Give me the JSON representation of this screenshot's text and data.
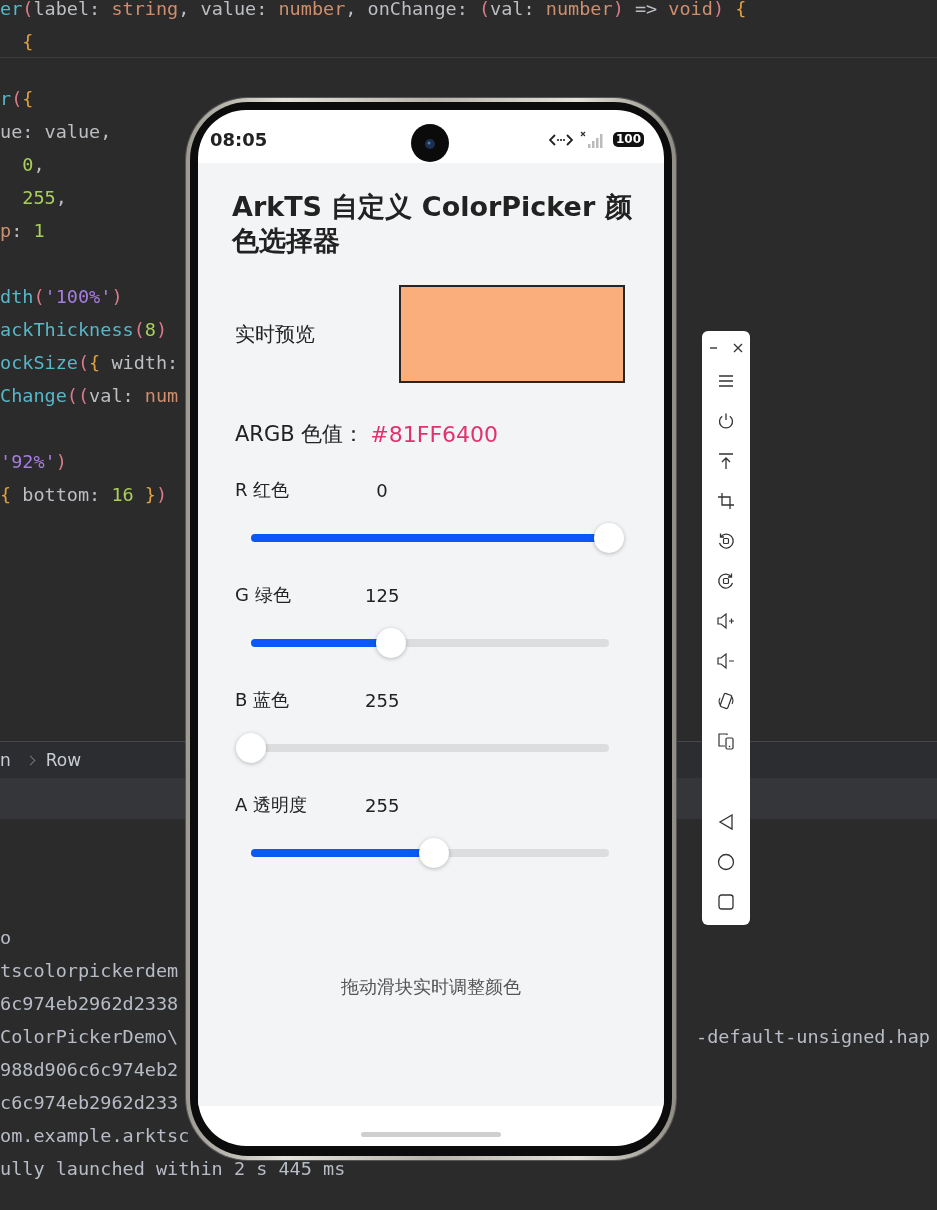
{
  "editor": {
    "header_lines": [
      {
        "tokens": [
          {
            "kind": "fn",
            "text": "er"
          },
          {
            "kind": "paren",
            "text": "("
          },
          {
            "kind": "id",
            "text": "label: "
          },
          {
            "kind": "kw",
            "text": "string"
          },
          {
            "kind": "id",
            "text": ", value: "
          },
          {
            "kind": "kw",
            "text": "number"
          },
          {
            "kind": "id",
            "text": ", onChange: "
          },
          {
            "kind": "paren",
            "text": "("
          },
          {
            "kind": "id",
            "text": "val: "
          },
          {
            "kind": "kw",
            "text": "number"
          },
          {
            "kind": "paren",
            "text": ")"
          },
          {
            "kind": "id",
            "text": " => "
          },
          {
            "kind": "kw",
            "text": "void"
          },
          {
            "kind": "paren",
            "text": ") "
          },
          {
            "kind": "brace",
            "text": "{"
          }
        ]
      },
      {
        "tokens": [
          {
            "kind": "brace",
            "text": "  {"
          }
        ]
      }
    ],
    "blocks": [
      [
        {
          "tokens": [
            {
              "kind": "fn",
              "text": "r"
            },
            {
              "kind": "paren",
              "text": "("
            },
            {
              "kind": "brace",
              "text": "{"
            }
          ]
        },
        {
          "tokens": [
            {
              "kind": "id",
              "text": "ue: value,"
            }
          ]
        },
        {
          "tokens": [
            {
              "kind": "num",
              "text": "  0"
            },
            {
              "kind": "id",
              "text": ","
            }
          ]
        },
        {
          "tokens": [
            {
              "kind": "num",
              "text": "  255"
            },
            {
              "kind": "id",
              "text": ","
            }
          ]
        },
        {
          "tokens": [
            {
              "kind": "kw",
              "text": "p"
            },
            {
              "kind": "id",
              "text": ": "
            },
            {
              "kind": "num",
              "text": "1"
            }
          ]
        }
      ],
      [
        {
          "tokens": [
            {
              "kind": "fn",
              "text": "dth"
            },
            {
              "kind": "paren",
              "text": "("
            },
            {
              "kind": "str",
              "text": "'100%'"
            },
            {
              "kind": "paren",
              "text": ")"
            }
          ]
        },
        {
          "tokens": [
            {
              "kind": "fn",
              "text": "ackThickness"
            },
            {
              "kind": "paren",
              "text": "("
            },
            {
              "kind": "num",
              "text": "8"
            },
            {
              "kind": "paren",
              "text": ")"
            }
          ]
        },
        {
          "tokens": [
            {
              "kind": "fn",
              "text": "ockSize"
            },
            {
              "kind": "paren",
              "text": "("
            },
            {
              "kind": "brace",
              "text": "{"
            },
            {
              "kind": "id",
              "text": " width:"
            }
          ]
        },
        {
          "tokens": [
            {
              "kind": "fn",
              "text": "Change"
            },
            {
              "kind": "paren",
              "text": "(("
            },
            {
              "kind": "id",
              "text": "val: "
            },
            {
              "kind": "kw",
              "text": "num"
            }
          ]
        }
      ],
      [
        {
          "tokens": [
            {
              "kind": "str",
              "text": "'92%'"
            },
            {
              "kind": "paren",
              "text": ")"
            }
          ]
        },
        {
          "tokens": [
            {
              "kind": "brace",
              "text": "{"
            },
            {
              "kind": "id",
              "text": " bottom: "
            },
            {
              "kind": "num",
              "text": "16"
            },
            {
              "kind": "brace",
              "text": " }"
            },
            {
              "kind": "paren",
              "text": ")"
            }
          ]
        }
      ]
    ]
  },
  "breadcrumb": [
    "n",
    "Row"
  ],
  "log": [
    {
      "text": "o"
    },
    {
      "text": "tscolorpickerdem"
    },
    {
      "text": "6c974eb2962d2338"
    },
    {
      "text": "ColorPickerDemo\\",
      "tail": "-default-unsigned.hap"
    },
    {
      "text": "988d906c6c974eb2"
    },
    {
      "text": "c6c974eb2962d233"
    },
    {
      "text": "om.example.arktsc"
    },
    {
      "text": "ully launched within 2 s 445 ms"
    }
  ],
  "phone": {
    "status_bar": {
      "time": "08:05",
      "battery": "100"
    },
    "title": "ArkTS 自定义 ColorPicker 颜色选择器",
    "preview": {
      "label": "实时预览",
      "color": "#f9ae7b"
    },
    "argb": {
      "label": "ARGB 色值：",
      "value": "#81FF6400"
    },
    "sliders": [
      {
        "label": "R 红色",
        "value": "0",
        "level": 1
      },
      {
        "label": "G 绿色",
        "value": "125",
        "level": 0.39
      },
      {
        "label": "B 蓝色",
        "value": "255",
        "level": 0
      },
      {
        "label": "A 透明度",
        "value": "255",
        "level": 0.51
      }
    ],
    "hint": "拖动滑块实时调整颜色"
  }
}
